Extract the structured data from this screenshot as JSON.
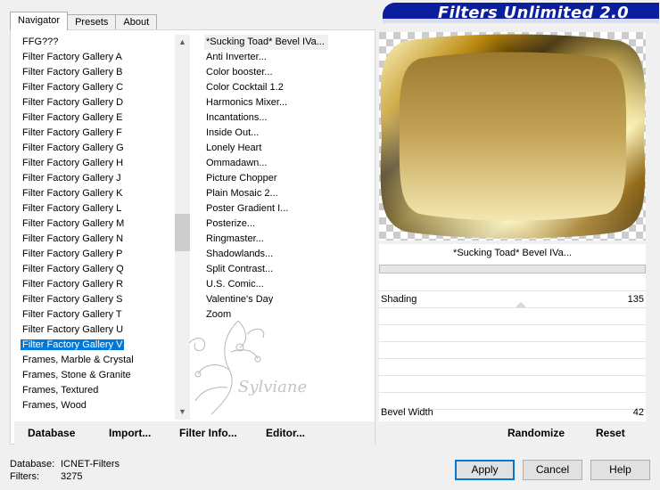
{
  "tabs": [
    "Navigator",
    "Presets",
    "About"
  ],
  "title": "Filters Unlimited 2.0",
  "categories": [
    "FFG???",
    "Filter Factory Gallery A",
    "Filter Factory Gallery B",
    "Filter Factory Gallery C",
    "Filter Factory Gallery D",
    "Filter Factory Gallery E",
    "Filter Factory Gallery F",
    "Filter Factory Gallery G",
    "Filter Factory Gallery H",
    "Filter Factory Gallery J",
    "Filter Factory Gallery K",
    "Filter Factory Gallery L",
    "Filter Factory Gallery M",
    "Filter Factory Gallery N",
    "Filter Factory Gallery P",
    "Filter Factory Gallery Q",
    "Filter Factory Gallery R",
    "Filter Factory Gallery S",
    "Filter Factory Gallery T",
    "Filter Factory Gallery U",
    "Filter Factory Gallery V",
    "Frames, Marble & Crystal",
    "Frames, Stone & Granite",
    "Frames, Textured",
    "Frames, Wood"
  ],
  "selected_category": "Filter Factory Gallery V",
  "filters": [
    "*Sucking Toad*  Bevel IVa...",
    "Anti Inverter...",
    "Color booster...",
    "Color Cocktail 1.2",
    "Harmonics Mixer...",
    "Incantations...",
    "Inside Out...",
    "Lonely Heart",
    "Ommadawn...",
    "Picture Chopper",
    "Plain Mosaic 2...",
    "Poster Gradient I...",
    "Posterize...",
    "Ringmaster...",
    "Shadowlands...",
    "Split Contrast...",
    "U.S. Comic...",
    "Valentine's Day",
    "Zoom"
  ],
  "selected_filter": "*Sucking Toad*  Bevel IVa...",
  "watermark_text": "Sylviane",
  "toolbar": {
    "database_label": "Database",
    "import_label": "Import...",
    "filter_info_label": "Filter Info...",
    "editor_label": "Editor..."
  },
  "panel": {
    "filter_name": "*Sucking Toad*  Bevel IVa...",
    "params": [
      {
        "label": "Shading",
        "value": "135"
      },
      {
        "label": "Bevel Width",
        "value": "42"
      }
    ],
    "randomize_label": "Randomize",
    "reset_label": "Reset"
  },
  "info": {
    "database_label": "Database:",
    "database_value": "ICNET-Filters",
    "filters_label": "Filters:",
    "filters_value": "3275"
  },
  "buttons": {
    "apply": "Apply",
    "cancel": "Cancel",
    "help": "Help"
  },
  "colors": {
    "banner": "#0b1f9e",
    "selection": "#0078d7"
  }
}
